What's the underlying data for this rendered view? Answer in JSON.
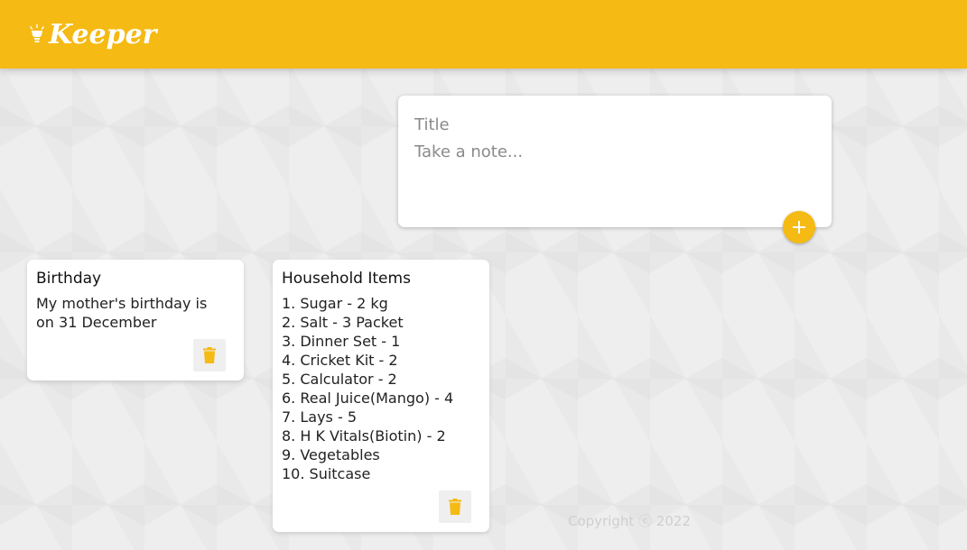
{
  "header": {
    "brand_name": "Keeper",
    "brand_icon": "light-bulb-icon",
    "accent_color": "#f5ba13"
  },
  "create_note": {
    "title_placeholder": "Title",
    "content_placeholder": "Take a note...",
    "add_icon": "plus-icon"
  },
  "notes": [
    {
      "title": "Birthday",
      "content": "My mother's birthday is\non 31 December",
      "delete_icon": "trash-icon"
    },
    {
      "title": "Household Items",
      "content": "1. Sugar - 2 kg\n2. Salt - 3 Packet\n3. Dinner Set - 1\n4. Cricket Kit - 2\n5. Calculator - 2\n6. Real Juice(Mango) - 4\n7. Lays - 5\n8. H K Vitals(Biotin) - 2\n9. Vegetables\n10. Suitcase",
      "delete_icon": "trash-icon"
    }
  ],
  "footer": {
    "copyright": "Copyright ⓒ 2022"
  }
}
